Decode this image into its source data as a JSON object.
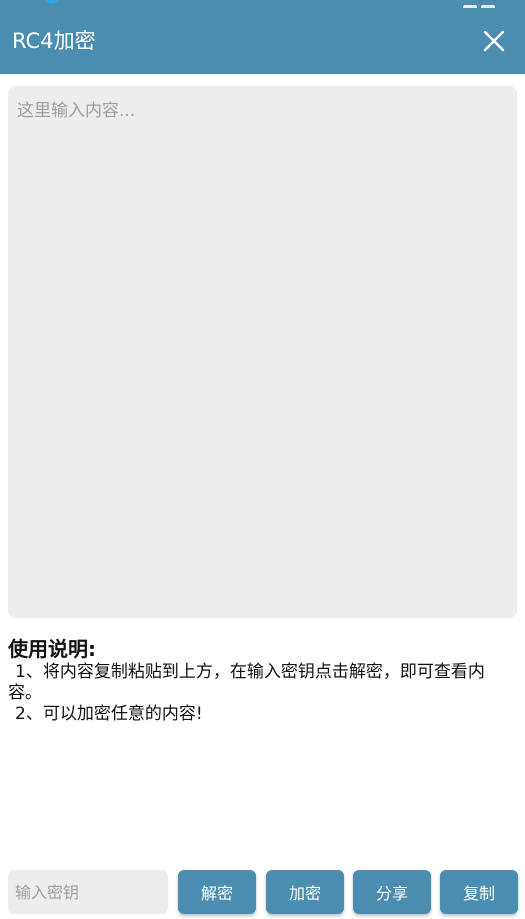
{
  "toolbar": {
    "title": "RC4加密",
    "close_icon": "close-icon"
  },
  "editor": {
    "placeholder": "这里输入内容..."
  },
  "instructions": {
    "title": "使用说明:",
    "items": [
      "1、将内容复制粘贴到上方，在输入密钥点击解密，即可查看内容。",
      "2、可以加密任意的内容!"
    ]
  },
  "bottom_bar": {
    "key_placeholder": "输入密钥",
    "decrypt_label": "解密",
    "encrypt_label": "加密",
    "share_label": "分享",
    "copy_label": "复制"
  },
  "colors": {
    "accent": "#4a8db0",
    "input_bg": "#ededed"
  }
}
